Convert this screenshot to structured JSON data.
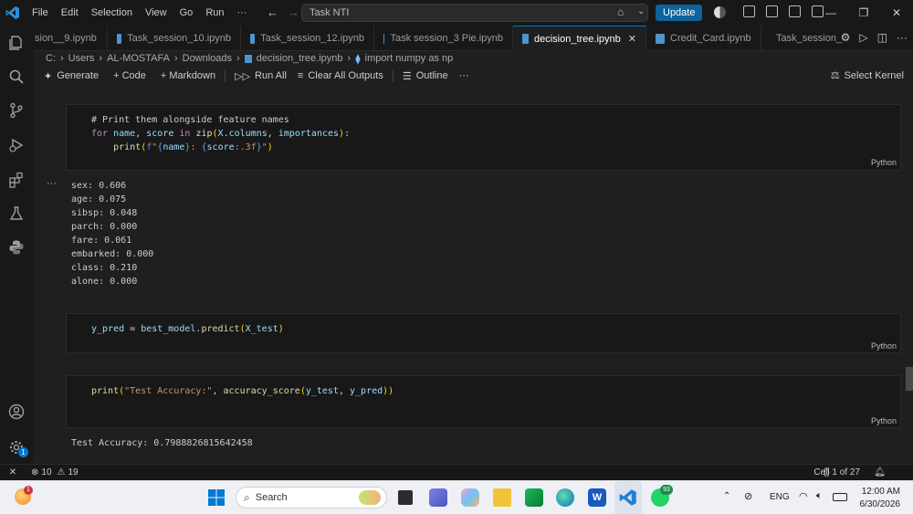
{
  "app": {
    "menu": [
      "File",
      "Edit",
      "Selection",
      "View",
      "Go",
      "Run",
      "···"
    ],
    "search_text": "Task NTI",
    "update_label": "Update"
  },
  "tabs": [
    {
      "label": "sion__9.ipynb",
      "active": false
    },
    {
      "label": "Task_session_10.ipynb",
      "active": false
    },
    {
      "label": "Task_session_12.ipynb",
      "active": false
    },
    {
      "label": "Task session_3 Pie.ipynb",
      "active": false
    },
    {
      "label": "decision_tree.ipynb",
      "active": true
    },
    {
      "label": "Credit_Card.ipynb",
      "active": false
    },
    {
      "label": "Task_session_",
      "active": false
    }
  ],
  "breadcrumb": {
    "parts": [
      "C:",
      "Users",
      "AL-MOSTAFA",
      "Downloads",
      "decision_tree.ipynb",
      "import numpy as np"
    ]
  },
  "toolbar": {
    "generate": "Generate",
    "code": "+ Code",
    "markdown": "+ Markdown",
    "run_all": "Run All",
    "clear": "Clear All Outputs",
    "outline": "Outline",
    "more": "···",
    "kernel": "Select Kernel"
  },
  "cells": {
    "cell1": {
      "comment": "# Print them alongside feature names",
      "line2": "for name, score in zip(X.columns, importances):",
      "line3": "    print(f\"{name}: {score:.3f}\")",
      "lang": "Python",
      "output": [
        "sex: 0.606",
        "age: 0.075",
        "sibsp: 0.048",
        "parch: 0.000",
        "fare: 0.061",
        "embarked: 0.000",
        "class: 0.210",
        "alone: 0.000"
      ]
    },
    "cell2": {
      "code": "y_pred = best_model.predict(X_test)",
      "lang": "Python"
    },
    "cell3": {
      "code": "print(\"Test Accuracy:\", accuracy_score(y_test, y_pred))",
      "lang": "Python",
      "output": "Test Accuracy: 0.7988826815642458"
    }
  },
  "status": {
    "errors": "10",
    "warnings": "19",
    "cell_position": "Cell 1 of 27"
  },
  "taskbar": {
    "search": "Search",
    "lang": "ENG",
    "time": "12:00 AM",
    "date": "6/30/2026",
    "whatsapp_badge": "93",
    "weather_badge": "1"
  }
}
